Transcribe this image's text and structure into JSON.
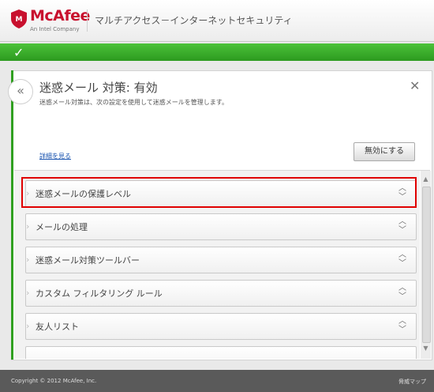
{
  "header": {
    "brand": "McAfee",
    "brand_sub": "An Intel Company",
    "product_title": "マルチアクセス－インターネットセキュリティ"
  },
  "status": {
    "icon": "check-icon",
    "color": "#3aad2a"
  },
  "feature": {
    "title": "迷惑メール 対策: 有効",
    "description": "迷惑メール対策は、次の設定を使用して迷惑メールを管理します。",
    "details_link": "詳細を見る",
    "disable_button": "無効にする"
  },
  "settings": {
    "items": [
      {
        "label": "迷惑メールの保護レベル"
      },
      {
        "label": "メールの処理"
      },
      {
        "label": "迷惑メール対策ツールバー"
      },
      {
        "label": "カスタム フィルタリング ルール"
      },
      {
        "label": "友人リスト"
      }
    ]
  },
  "footer": {
    "copyright": "Copyright © 2012 McAfee, Inc.",
    "threat_map": "脅威マップ"
  },
  "colors": {
    "brand_red": "#c8102e",
    "highlight": "#e00000",
    "link": "#1b55b0"
  }
}
